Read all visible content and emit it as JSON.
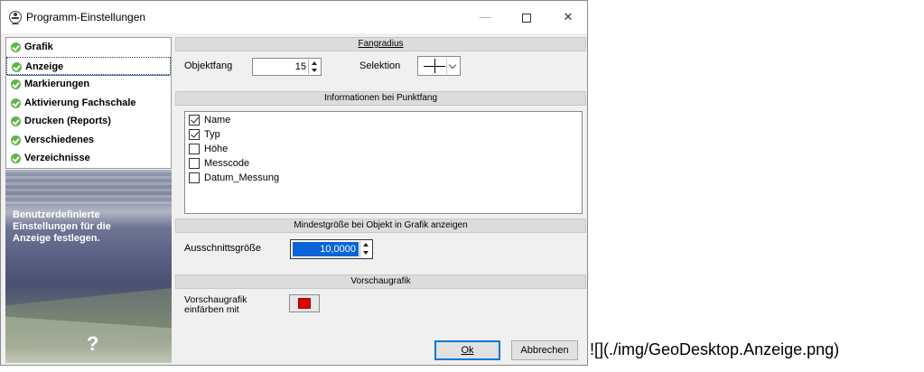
{
  "window": {
    "title": "Programm-Einstellungen",
    "controls": {
      "minimize": "—",
      "close": "✕"
    }
  },
  "nav": {
    "items": [
      {
        "label": "Grafik",
        "icon": "check-circle-icon",
        "active": false
      },
      {
        "label": "Anzeige",
        "icon": "check-circle-icon",
        "active": true
      },
      {
        "label": "Markierungen",
        "icon": "check-circle-icon",
        "active": false
      },
      {
        "label": "Aktivierung Fachschale",
        "icon": "check-circle-icon",
        "active": false
      },
      {
        "label": "Drucken (Reports)",
        "icon": "check-circle-icon",
        "active": false
      },
      {
        "label": "Verschiedenes",
        "icon": "check-circle-icon",
        "active": false
      },
      {
        "label": "Verzeichnisse",
        "icon": "check-circle-icon",
        "active": false
      }
    ],
    "accent_color": "#5fb54a"
  },
  "side_panel": {
    "description": "Benutzerdefinierte\nEinstellungen für die\nAnzeige festlegen.",
    "help_glyph": "?"
  },
  "fangradius": {
    "header": "Fangradius",
    "objektfang_label": "Objektfang",
    "objektfang_value": "15",
    "selektion_label": "Selektion",
    "selektion_icon": "crosshair-icon"
  },
  "punktfang": {
    "header": "Informationen bei Punktfang",
    "options": [
      {
        "label": "Name",
        "checked": true
      },
      {
        "label": "Typ",
        "checked": true
      },
      {
        "label": "Höhe",
        "checked": false
      },
      {
        "label": "Messcode",
        "checked": false
      },
      {
        "label": "Datum_Messung",
        "checked": false
      }
    ]
  },
  "mindestgroesse": {
    "header": "Mindestgröße bei Objekt in Grafik anzeigen",
    "label": "Ausschnittsgröße",
    "value": "10,0000",
    "selection_color": "#0a64d8"
  },
  "vorschau": {
    "header": "Vorschaugrafik",
    "label_line1": "Vorschaugrafik",
    "label_line2": "einfärben mit",
    "swatch_color": "#e00000"
  },
  "buttons": {
    "ok": "Ok",
    "cancel": "Abbrechen"
  },
  "caption": "![](./img/GeoDesktop.Anzeige.png)"
}
